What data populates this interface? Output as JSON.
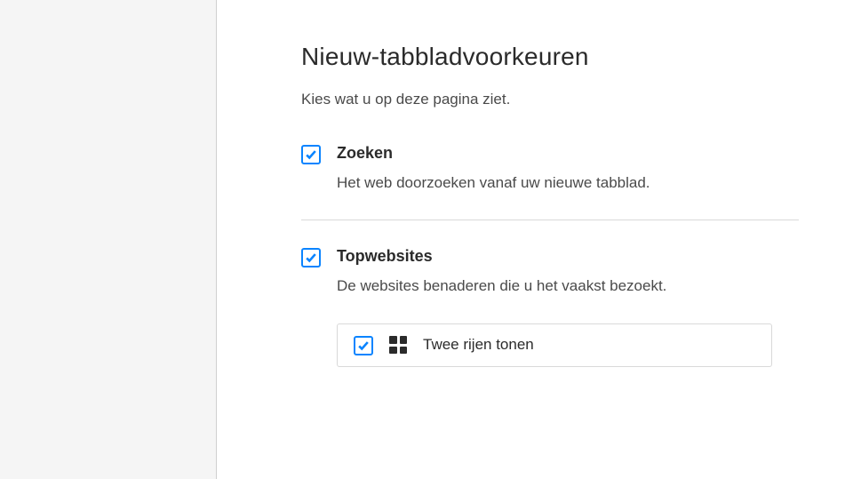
{
  "page": {
    "title": "Nieuw-tabbladvoorkeuren",
    "subtitle": "Kies wat u op deze pagina ziet."
  },
  "prefs": {
    "search": {
      "label": "Zoeken",
      "desc": "Het web doorzoeken vanaf uw nieuwe tabblad."
    },
    "topSites": {
      "label": "Topwebsites",
      "desc": "De websites benaderen die u het vaakst bezoekt.",
      "subOption": {
        "label": "Twee rijen tonen"
      }
    }
  }
}
